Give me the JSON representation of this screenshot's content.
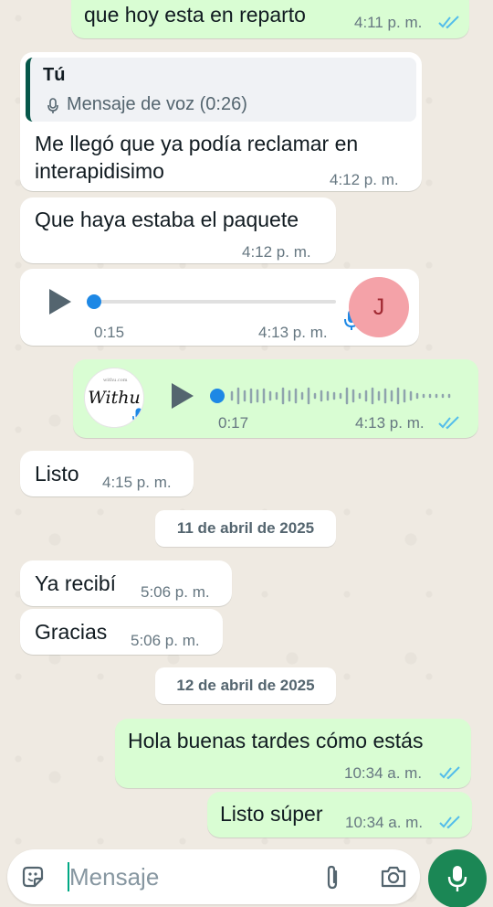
{
  "messages": [
    {
      "text": "que hoy esta en reparto",
      "time": "4:11 p. m."
    },
    {
      "quote_author": "Tú",
      "quote_text": "Mensaje de voz (0:26)",
      "text_line1": "Me llegó que ya podía reclamar en",
      "text_line2": "interapidisimo",
      "time": "4:12 p. m."
    },
    {
      "text": "Que haya estaba el paquete",
      "time": "4:12 p. m."
    },
    {
      "audio_duration": "0:15",
      "time": "4:13 p. m.",
      "avatar_initial": "J"
    },
    {
      "audio_duration": "0:17",
      "time": "4:13 p. m.",
      "avatar_text": "Withu",
      "avatar_tiny": "withu.com"
    },
    {
      "text": "Listo",
      "time": "4:15 p. m."
    },
    {
      "text": "Ya recibí",
      "time": "5:06 p. m."
    },
    {
      "text": "Gracias",
      "time": "5:06 p. m."
    },
    {
      "text": "Hola buenas tardes cómo estás",
      "time": "10:34 a. m."
    },
    {
      "text": "Listo súper",
      "time": "10:34 a. m."
    }
  ],
  "dates": [
    "11 de abril de 2025",
    "12 de abril de 2025"
  ],
  "composer": {
    "placeholder": "Mensaje"
  },
  "colors": {
    "outgoing": "#d9fdd3",
    "incoming": "#ffffff",
    "read_ticks": "#53bdeb",
    "accent": "#1b8755",
    "voice_dot": "#1e88e5"
  },
  "icons": [
    "sticker-icon",
    "attach-icon",
    "camera-icon",
    "mic-icon",
    "play-icon",
    "double-check-icon"
  ]
}
